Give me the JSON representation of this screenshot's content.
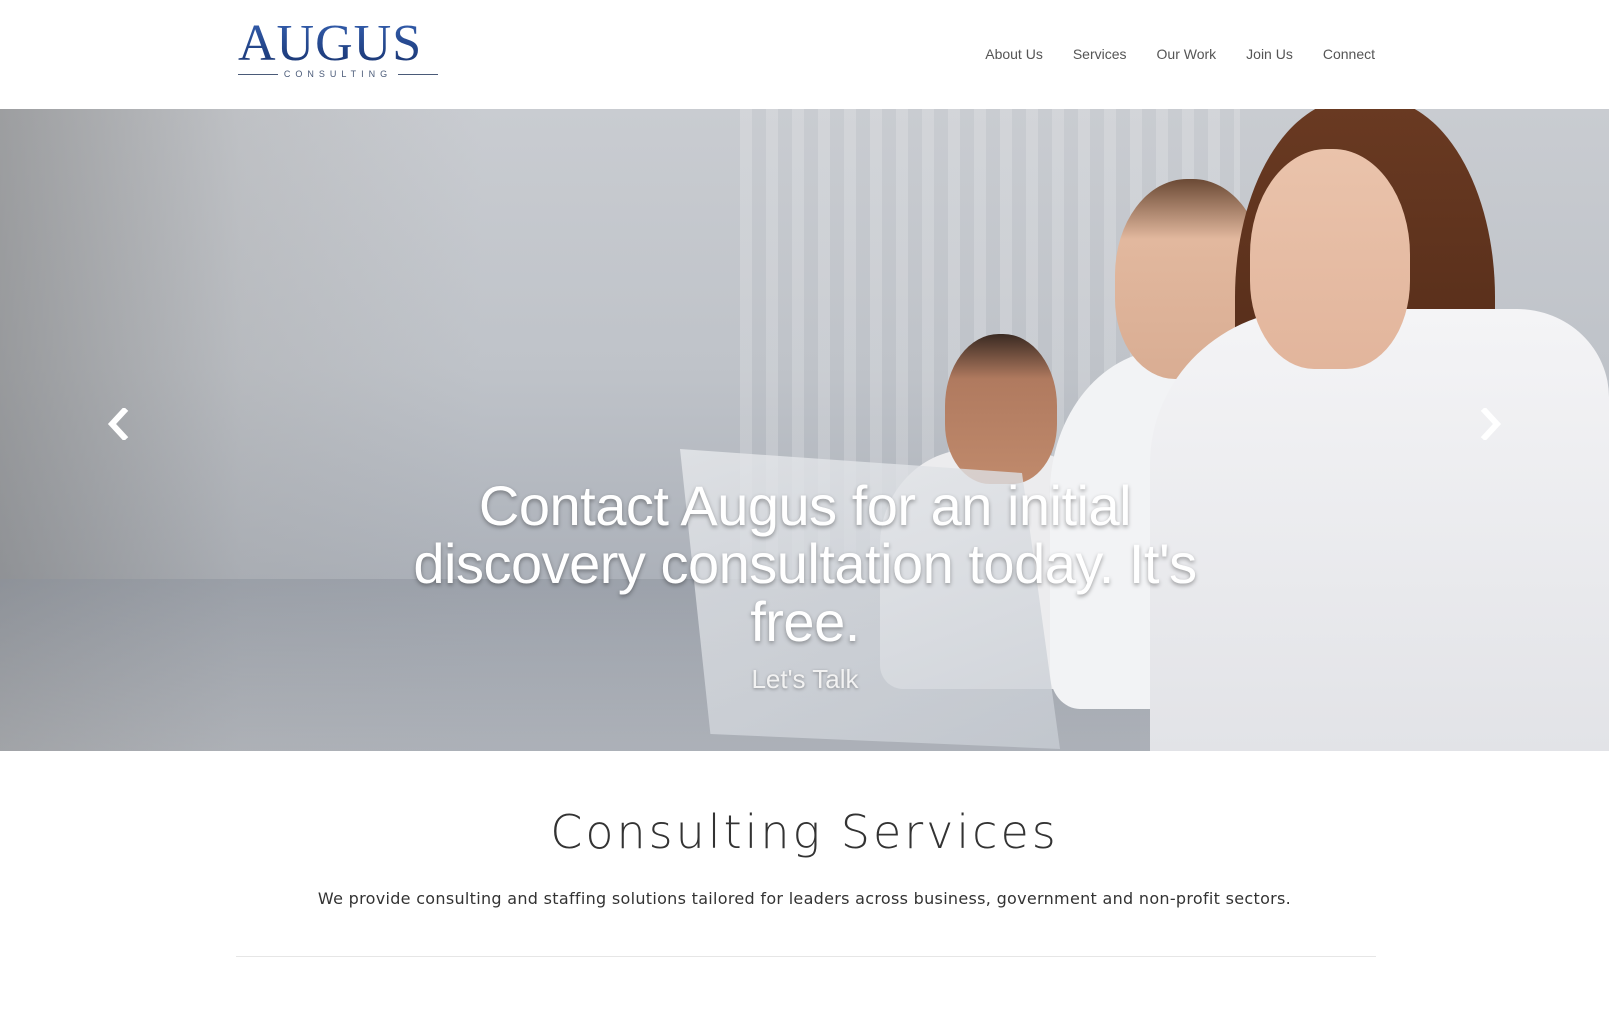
{
  "header": {
    "logo": {
      "word": "AUGUS",
      "sub": "CONSULTING"
    },
    "nav": [
      "About Us",
      "Services",
      "Our Work",
      "Join Us",
      "Connect"
    ]
  },
  "hero": {
    "title": "Contact Augus for an initial discovery consultation today. It's free.",
    "cta": "Let's Talk",
    "prev_icon": "chevron-left-icon",
    "next_icon": "chevron-right-icon"
  },
  "services": {
    "title": "Consulting Services",
    "description": "We provide consulting and staffing solutions tailored for leaders across business, government and non-profit sectors."
  }
}
